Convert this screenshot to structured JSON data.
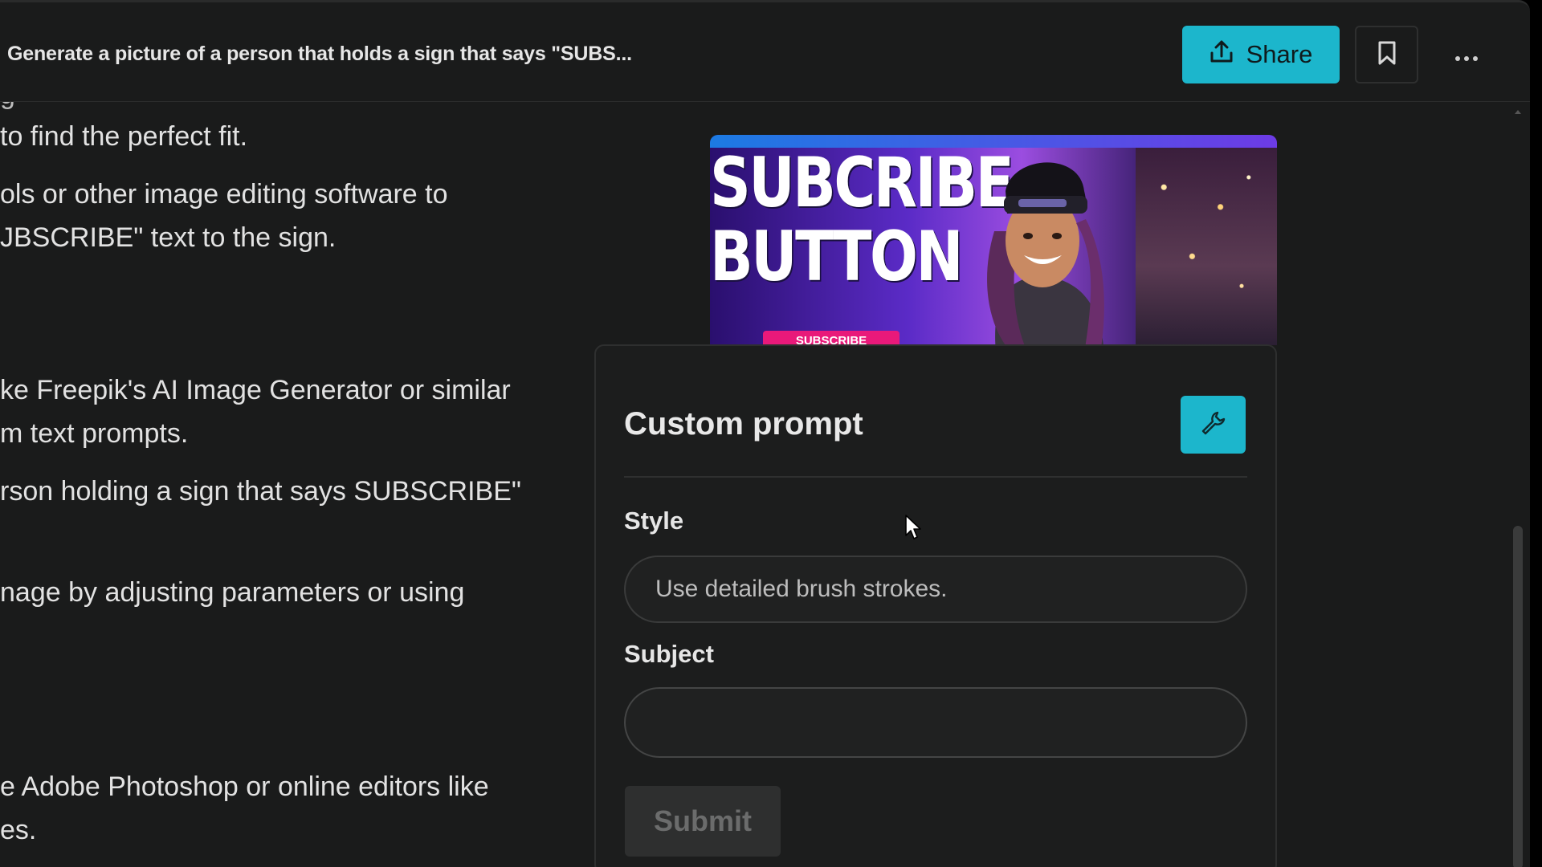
{
  "header": {
    "title": "Generate a picture of a person that holds a sign that says \"SUBS...",
    "share_label": "Share",
    "share_icon": "upload-icon",
    "bookmark_icon": "bookmark-icon",
    "more_icon": "ellipsis-icon",
    "accent": "#1cb6cc"
  },
  "chat": {
    "lines": [
      "to find the perfect fit.",
      "ols or other image editing software to",
      "JBSCRIBE\" text to the sign.",
      "ke Freepik's AI Image Generator or similar",
      "m text prompts.",
      "rson holding a sign that says SUBSCRIBE\"",
      "nage by adjusting parameters or using",
      "e Adobe Photoshop or online editors like",
      "es."
    ]
  },
  "thumbnail": {
    "line1": "SUBCRIBE",
    "line2": "BUTTON",
    "pill": "SUBSCRIBE"
  },
  "custom_prompt": {
    "title": "Custom prompt",
    "settings_icon": "wrench-icon",
    "style_label": "Style",
    "style_placeholder": "Use detailed brush strokes.",
    "subject_label": "Subject",
    "subject_value": "",
    "submit_label": "Submit"
  }
}
